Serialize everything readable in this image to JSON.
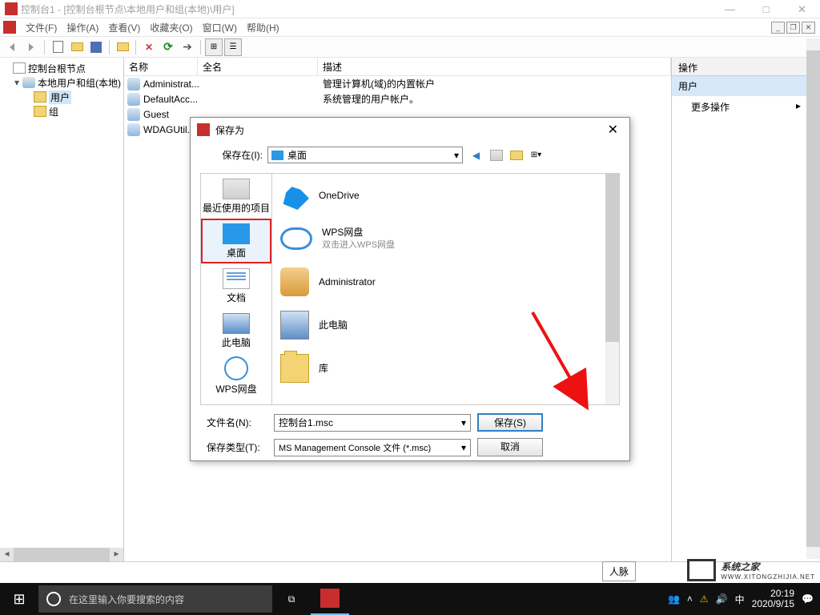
{
  "window": {
    "title": "控制台1 - [控制台根节点\\本地用户和组(本地)\\用户]",
    "ctrl_min": "—",
    "ctrl_max": "□",
    "ctrl_close": "✕"
  },
  "menus": {
    "file": "文件(F)",
    "action": "操作(A)",
    "view": "查看(V)",
    "fav": "收藏夹(O)",
    "window": "窗口(W)",
    "help": "帮助(H)"
  },
  "mdi": {
    "min": "_",
    "max": "❐",
    "close": "✕"
  },
  "tree": {
    "root": "控制台根节点",
    "group": "本地用户和组(本地)",
    "users": "用户",
    "groups": "组"
  },
  "list": {
    "col_name": "名称",
    "col_full": "全名",
    "col_desc": "描述",
    "rows": [
      {
        "name": "Administrat...",
        "full": "",
        "desc": "管理计算机(域)的内置帐户"
      },
      {
        "name": "DefaultAcc...",
        "full": "",
        "desc": "系统管理的用户帐户。"
      },
      {
        "name": "Guest",
        "full": "",
        "desc": ""
      },
      {
        "name": "WDAGUtil...",
        "full": "",
        "desc": ""
      }
    ]
  },
  "actions": {
    "head": "操作",
    "sub": "用户",
    "more": "更多操作"
  },
  "dialog": {
    "title": "保存为",
    "savein_lbl": "保存在(I):",
    "savein_val": "桌面",
    "side": {
      "recent": "最近使用的项目",
      "desktop": "桌面",
      "docs": "文档",
      "pc": "此电脑",
      "wps": "WPS网盘"
    },
    "files": [
      {
        "name": "OneDrive",
        "sub": "",
        "icon": "onedrive"
      },
      {
        "name": "WPS网盘",
        "sub": "双击进入WPS网盘",
        "icon": "cloud"
      },
      {
        "name": "Administrator",
        "sub": "",
        "icon": "user"
      },
      {
        "name": "此电脑",
        "sub": "",
        "icon": "pc"
      },
      {
        "name": "库",
        "sub": "",
        "icon": "lib"
      }
    ],
    "filename_lbl": "文件名(N):",
    "filename_val": "控制台1.msc",
    "filetype_lbl": "保存类型(T):",
    "filetype_val": "MS Management Console 文件 (*.msc)",
    "btn_save": "保存(S)",
    "btn_cancel": "取消"
  },
  "taskbar": {
    "search": "在这里输入你要搜索的内容",
    "people_tip": "人脉",
    "time": "20:19",
    "date": "2020/9/15"
  },
  "watermark": {
    "text": "系统之家",
    "sub": "WWW.XITONGZHIJIA.NET"
  }
}
